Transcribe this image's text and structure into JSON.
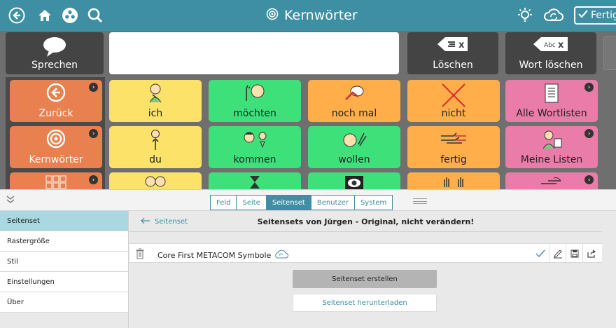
{
  "topbar": {
    "title": "Kernwörter",
    "done_label": "Fertig",
    "icons": [
      "back-icon",
      "home-icon",
      "menu-icon",
      "search-icon",
      "lightbulb-icon",
      "cloud-sync-icon"
    ]
  },
  "speech": {
    "speak_label": "Sprechen",
    "delete_label": "Löschen",
    "delete_word_label": "Wort löschen",
    "delete_badge": "x",
    "delete_word_badge": "Abc"
  },
  "grid": {
    "nav": [
      {
        "label": "Zurück",
        "icon": "back-circle-icon"
      },
      {
        "label": "Kernwörter",
        "icon": "target-icon"
      },
      {
        "label": "",
        "icon": "alphabet-icon"
      }
    ],
    "words": [
      {
        "label": "ich",
        "color": "#fde26a"
      },
      {
        "label": "möchten",
        "color": "#3ee07a"
      },
      {
        "label": "noch mal",
        "color": "#ffae4a"
      },
      {
        "label": "nicht",
        "color": "#ffae4a"
      },
      {
        "label": "Alle Wortlisten",
        "color": "#e97ca8"
      },
      {
        "label": "du",
        "color": "#fde26a"
      },
      {
        "label": "kommen",
        "color": "#3ee07a"
      },
      {
        "label": "wollen",
        "color": "#3ee07a"
      },
      {
        "label": "fertig",
        "color": "#ffae4a"
      },
      {
        "label": "Meine Listen",
        "color": "#e97ca8"
      }
    ]
  },
  "panel": {
    "tabs": [
      {
        "label": "Feld",
        "active": false
      },
      {
        "label": "Seite",
        "active": false
      },
      {
        "label": "Seitenset",
        "active": true
      },
      {
        "label": "Benutzer",
        "active": false
      },
      {
        "label": "System",
        "active": false
      }
    ],
    "sidebar": [
      {
        "label": "Seitenset",
        "active": true
      },
      {
        "label": "Rastergröße",
        "active": false
      },
      {
        "label": "Stil",
        "active": false
      },
      {
        "label": "Einstellungen",
        "active": false
      },
      {
        "label": "Über",
        "active": false
      }
    ],
    "back_label": "Seitenset",
    "heading": "Seitensets von Jürgen - Original, nicht verändern!",
    "pageset_name": "Core First METACOM Symbole",
    "create_label": "Seitenset erstellen",
    "download_label": "Seitenset herunterladen"
  },
  "colors": {
    "accent": "#3e8fa3",
    "nav": "#e8804f",
    "yellow": "#fde26a",
    "green": "#3ee07a",
    "orange": "#ffae4a",
    "pink": "#e97ca8"
  }
}
